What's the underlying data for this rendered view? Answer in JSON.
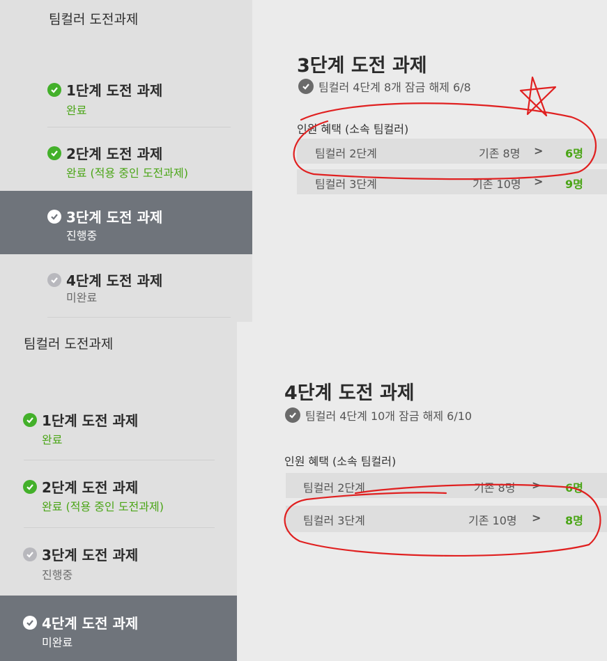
{
  "panels": [
    {
      "sidebar": {
        "title": "팀컬러 도전과제",
        "steps": [
          {
            "name": "1단계 도전 과제",
            "status": "완료"
          },
          {
            "name": "2단계 도전 과제",
            "status": "완료 (적용 중인 도전과제)"
          },
          {
            "name": "3단계 도전 과제",
            "status": "진행중"
          },
          {
            "name": "4단계 도전 과제",
            "status": "미완료"
          }
        ]
      },
      "main": {
        "title": "3단계 도전 과제",
        "unlock_text": "팀컬러 4단계 8개 잠금 해제 6/8",
        "benefit_label": "인원 혜택 (소속 팀컬러)",
        "benefits": [
          {
            "name": "팀컬러 2단계",
            "base": "기존 8명",
            "arrow": ">",
            "new": "6명"
          },
          {
            "name": "팀컬러 3단계",
            "base": "기존 10명",
            "arrow": ">",
            "new": "9명"
          }
        ]
      }
    },
    {
      "sidebar": {
        "title": "팀컬러 도전과제",
        "steps": [
          {
            "name": "1단계 도전 과제",
            "status": "완료"
          },
          {
            "name": "2단계 도전 과제",
            "status": "완료 (적용 중인 도전과제)"
          },
          {
            "name": "3단계 도전 과제",
            "status": "진행중"
          },
          {
            "name": "4단계 도전 과제",
            "status": "미완료"
          }
        ]
      },
      "main": {
        "title": "4단계 도전 과제",
        "unlock_text": "팀컬러 4단계 10개 잠금 해제 6/10",
        "benefit_label": "인원 혜택 (소속 팀컬러)",
        "benefits": [
          {
            "name": "팀컬러 2단계",
            "base": "기존 8명",
            "arrow": ">",
            "new": "6명"
          },
          {
            "name": "팀컬러 3단계",
            "base": "기존 10명",
            "arrow": ">",
            "new": "8명"
          }
        ]
      }
    }
  ],
  "colors": {
    "complete_green": "#43b02a",
    "active_step_bg": "#6f747b",
    "annotation_red": "#e02020"
  }
}
